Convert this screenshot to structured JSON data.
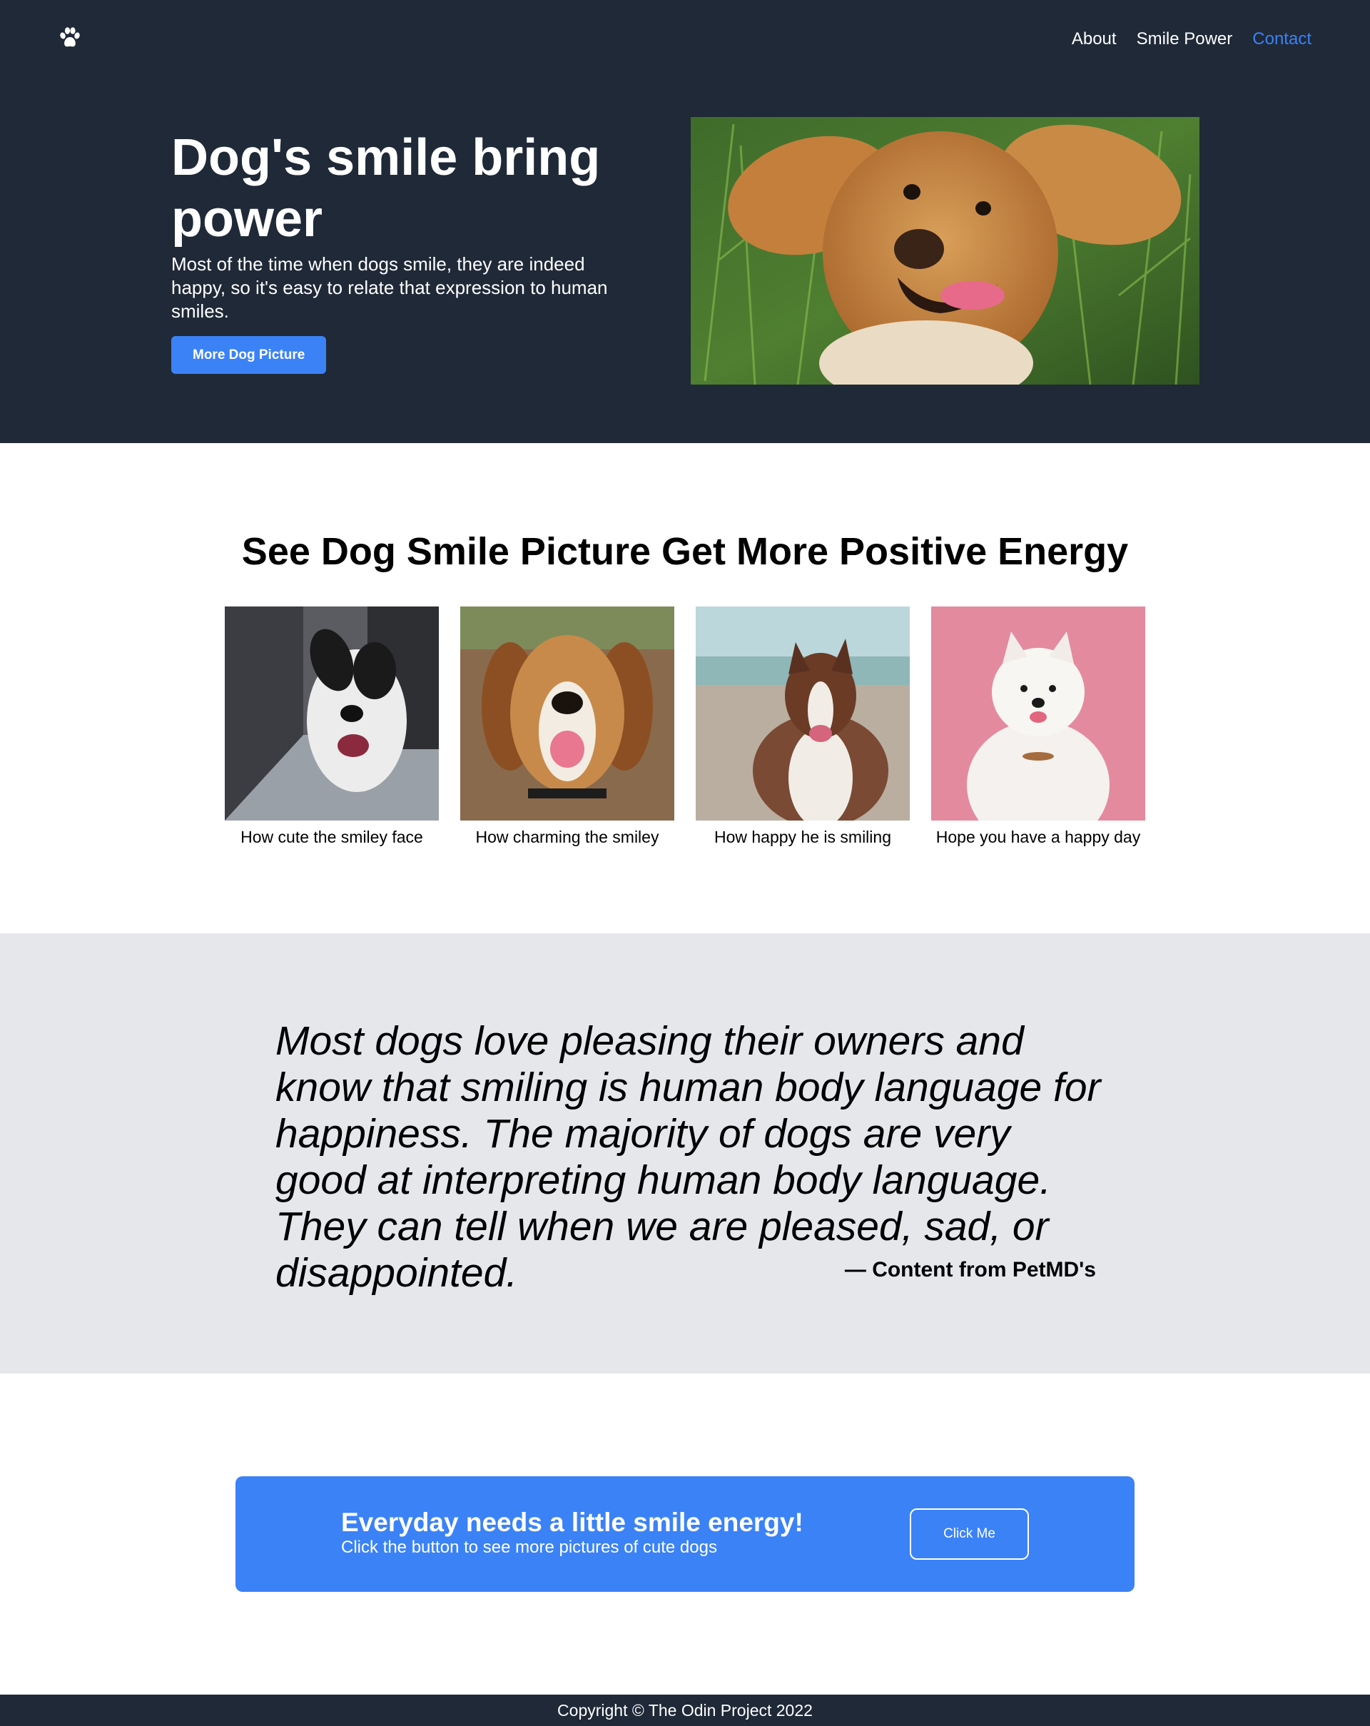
{
  "nav": {
    "logo_icon": "paw-icon",
    "links": [
      "About",
      "Smile Power",
      "Contact"
    ],
    "active_link": "Contact"
  },
  "hero": {
    "title": "Dog's smile bring power",
    "subtitle": "Most of the time when dogs smile, they are indeed happy, so it's easy to relate that expression to human smiles.",
    "button_label": "More Dog Picture",
    "image": "dog-lying-in-grass-photo"
  },
  "pictures": {
    "title": "See Dog Smile Picture Get More Positive Energy",
    "cards": [
      {
        "caption": "How cute the smiley face",
        "image": "black-white-dog-photo"
      },
      {
        "caption": "How charming the smiley",
        "image": "beagle-photo"
      },
      {
        "caption": "How happy he is smiling",
        "image": "border-collie-beach-photo"
      },
      {
        "caption": "Hope you have a happy day",
        "image": "samoyed-pink-photo"
      }
    ]
  },
  "quote": {
    "text": "Most dogs love pleasing their owners and know that smiling is human body language for happiness. The majority of dogs are very good at interpreting human body language. They can tell when we are pleased, sad, or disappointed.",
    "source": "— Content from PetMD's"
  },
  "cta": {
    "title": "Everyday needs a little smile energy!",
    "subtitle": "Click the button to see more pictures of cute dogs",
    "button_label": "Click Me"
  },
  "footer": {
    "text": "Copyright © The Odin Project 2022"
  },
  "colors": {
    "dark": "#1f2937",
    "accent": "#3b82f6",
    "quote_bg": "#e5e7eb"
  }
}
